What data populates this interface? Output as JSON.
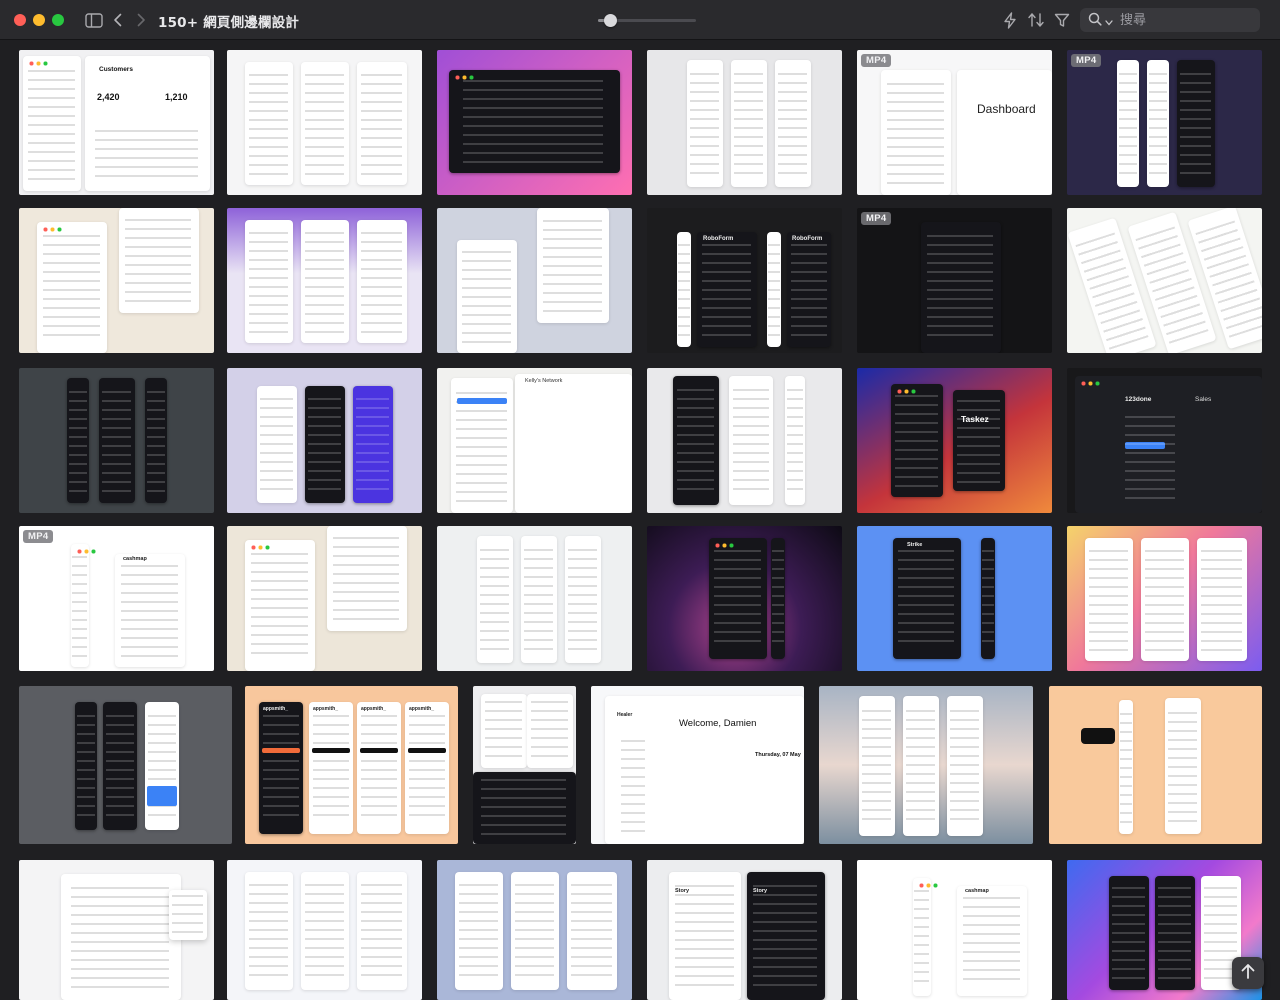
{
  "window": {
    "title": "150+ 網頁側邊欄設計"
  },
  "toolbar": {
    "zoom_level": 0.13,
    "search": {
      "placeholder": "搜尋",
      "value": ""
    },
    "icons": [
      "sidebar-toggle-icon",
      "chevron-left-icon",
      "chevron-right-icon",
      "bolt-icon",
      "sort-icon",
      "filter-icon",
      "search-icon",
      "chevron-down-icon"
    ]
  },
  "grid": {
    "badge_label": "MP4",
    "thumbs": {
      "customers": {
        "title": "Customers",
        "stat1": "2,420",
        "stat2": "1,210"
      },
      "dashboard": {
        "title": "Dashboard"
      },
      "roboform": {
        "label1": "RoboForm",
        "label2": "RoboForm"
      },
      "kellys": {
        "label": "Kelly's Network"
      },
      "taskez": {
        "label": "Taskez"
      },
      "onetwothree": {
        "title": "123done",
        "subtitle": "Sales"
      },
      "cashmap": {
        "label": "cashmap"
      },
      "strike": {
        "label": "Strike"
      },
      "appsmith": {
        "labels": [
          "appsmith_",
          "appsmith_",
          "appsmith_",
          "appsmith_"
        ]
      },
      "healer": {
        "brand": "Healer",
        "greeting": "Welcome, Damien",
        "date": "Thursday, 07 May"
      },
      "story": {
        "label1": "Story",
        "label2": "Story"
      },
      "cashmap2": {
        "label": "cashmap"
      }
    }
  },
  "colors": {
    "window_bg": "#1f1f22",
    "titlebar_bg": "#2a2a2d",
    "accent_blue": "#3b82f6"
  }
}
